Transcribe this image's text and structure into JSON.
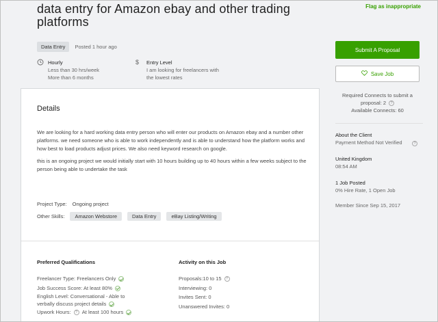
{
  "job": {
    "title": "data entry for Amazon ebay and other trading platforms",
    "flag_label": "Flag as inappropriate",
    "category": "Data Entry",
    "posted": "Posted 1 hour ago",
    "hourly_label": "Hourly",
    "hourly_sub1": "Less than 30 hrs/week",
    "hourly_sub2": "More than 6 months",
    "entry_label": "Entry Level",
    "entry_sub1": "I am looking for freelancers with",
    "entry_sub2": "the lowest rates"
  },
  "details": {
    "heading": "Details",
    "paragraph1": "We are looking for a hard working data entry person who will enter our products on Amazon ebay and a number other platforms.  we need someone who is able to work independently and is able to understand how the platform works and how best to load products adjust prices. We also need keyword research on google.",
    "paragraph2": "this is an ongoing project we would initially start with 10 hours building up to 40 hours within a few weeks subject to the person being able to undertake the task",
    "project_type_label": "Project Type:",
    "project_type_value": "Ongoing project",
    "skills_label": "Other Skills:",
    "skills": [
      "Amazon Webstore",
      "Data Entry",
      "eBay Listing/Writing"
    ]
  },
  "qualifications": {
    "heading": "Preferred Qualifications",
    "freelancer_type": "Freelancer Type: Freelancers Only",
    "job_success": "Job Success Score: At least 80%",
    "english_line1": "English Level: Conversational - Able to",
    "english_line2": "verbally discuss project details",
    "upwork_hours_label": "Upwork Hours:",
    "upwork_hours_value": "At least 100 hours"
  },
  "activity": {
    "heading": "Activity on this Job",
    "proposals": "Proposals:10 to 15",
    "interviewing": "Interviewing: 0",
    "invites": "Invites Sent: 0",
    "unanswered": "Unanswered Invites: 0"
  },
  "sidebar": {
    "submit_label": "Submit A Proposal",
    "save_label": "Save Job",
    "connects_line1": "Required Connects to submit a",
    "connects_line2": "proposal: 2",
    "connects_line3": "Available Connects: 60",
    "about_heading": "About the Client",
    "payment": "Payment Method Not Verified",
    "country": "United Kingdom",
    "time": "08:54 AM",
    "jobs_posted": "1 Job Posted",
    "hire_rate": "0% Hire Rate, 1 Open Job",
    "member_since": "Member Since Sep 15, 2017"
  },
  "colors": {
    "accent": "#37a000"
  },
  "icons": [
    "clock-icon",
    "dollar-icon",
    "heart-icon",
    "question-icon",
    "check-circle-icon"
  ]
}
